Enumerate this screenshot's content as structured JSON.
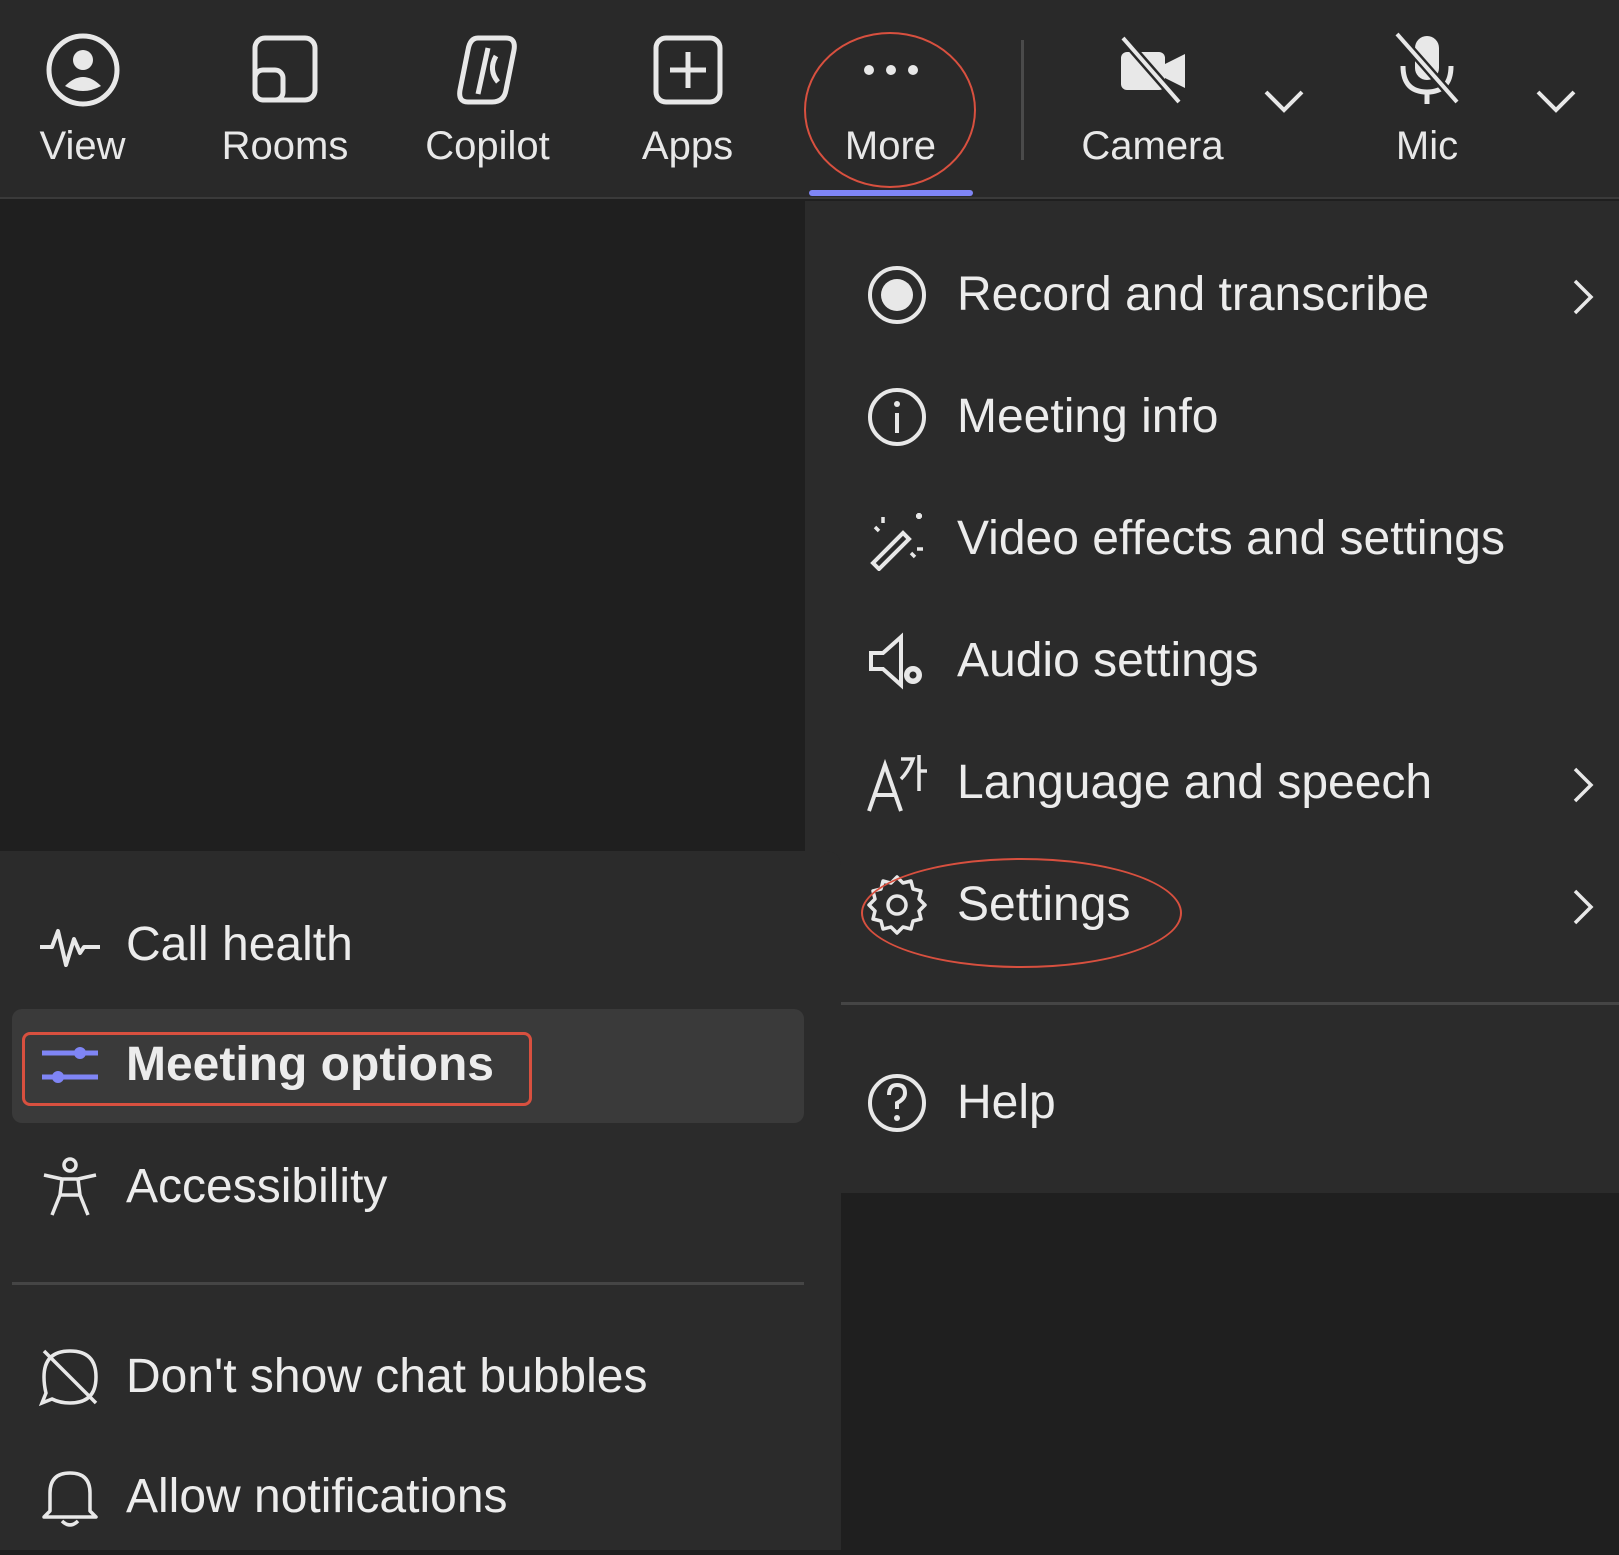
{
  "toolbar": {
    "buttons": [
      {
        "label": "View",
        "icon": "view-icon"
      },
      {
        "label": "Rooms",
        "icon": "rooms-icon"
      },
      {
        "label": "Copilot",
        "icon": "copilot-icon"
      },
      {
        "label": "Apps",
        "icon": "apps-icon"
      },
      {
        "label": "More",
        "icon": "more-icon"
      },
      {
        "label": "Camera",
        "icon": "camera-off-icon"
      },
      {
        "label": "Mic",
        "icon": "mic-off-icon"
      }
    ],
    "selected": "More",
    "accent_color": "#7f85f5"
  },
  "more_menu": {
    "items": [
      {
        "label": "Record and transcribe",
        "icon": "record-icon",
        "has_submenu": true
      },
      {
        "label": "Meeting info",
        "icon": "info-icon",
        "has_submenu": false
      },
      {
        "label": "Video effects and settings",
        "icon": "magic-wand-icon",
        "has_submenu": false
      },
      {
        "label": "Audio settings",
        "icon": "speaker-settings-icon",
        "has_submenu": false
      },
      {
        "label": "Language and speech",
        "icon": "language-icon",
        "has_submenu": true
      },
      {
        "label": "Settings",
        "icon": "gear-icon",
        "has_submenu": true
      }
    ],
    "footer_items": [
      {
        "label": "Help",
        "icon": "help-icon"
      }
    ]
  },
  "settings_submenu": {
    "items": [
      {
        "label": "Call health",
        "icon": "pulse-icon"
      },
      {
        "label": "Meeting options",
        "icon": "sliders-icon",
        "selected": true
      },
      {
        "label": "Accessibility",
        "icon": "accessibility-icon"
      }
    ],
    "footer_items": [
      {
        "label": "Don't show chat bubbles",
        "icon": "chat-bubble-off-icon"
      },
      {
        "label": "Allow notifications",
        "icon": "bell-icon"
      }
    ]
  },
  "annotation_color": "#d8503f"
}
